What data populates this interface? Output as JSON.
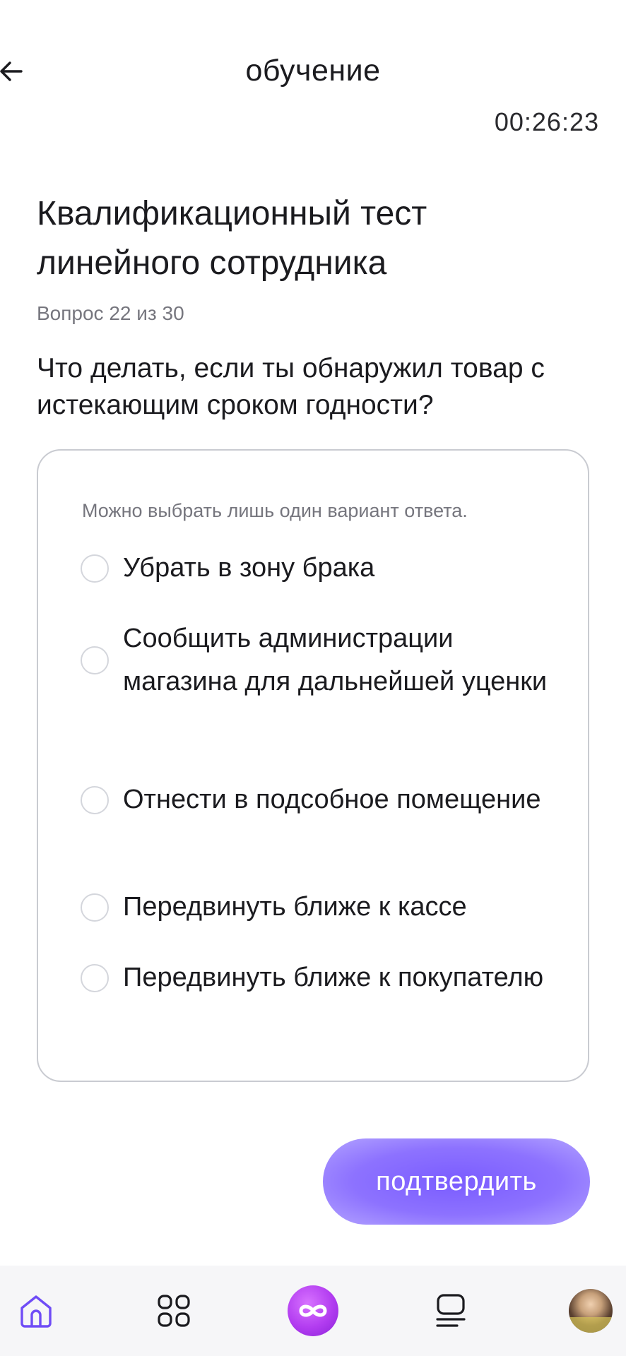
{
  "header": {
    "title": "обучение",
    "timer": "00:26:23"
  },
  "test": {
    "title": "Квалификационный тест линейного сотрудника",
    "progress": "Вопрос 22 из 30",
    "question": "Что делать, если ты обнаружил товар с истекающим сроком годности?",
    "hint": "Можно выбрать лишь один вариант ответа.",
    "options": [
      {
        "label": "Убрать в зону брака"
      },
      {
        "label": "Сообщить администрации магазина для дальнейшей уценки"
      },
      {
        "label": "Отнести в подсобное помещение"
      },
      {
        "label": "Передвинуть ближе к кассе"
      },
      {
        "label": "Передвинуть ближе к покупателю"
      }
    ],
    "confirm_label": "подтвердить"
  },
  "bottom_nav": {
    "items": [
      {
        "icon": "home-icon",
        "active": true
      },
      {
        "icon": "apps-grid-icon",
        "active": false
      },
      {
        "icon": "infinity-icon",
        "active": false
      },
      {
        "icon": "courses-icon",
        "active": false
      },
      {
        "icon": "avatar",
        "active": false
      }
    ],
    "active_color": "#6f4cf6",
    "accent_color": "#b23cf0"
  }
}
